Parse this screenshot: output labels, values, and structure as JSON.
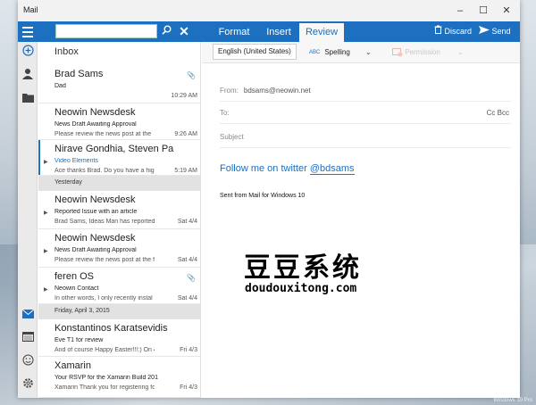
{
  "app": {
    "title": "Mail"
  },
  "window_controls": {
    "minimize": "–",
    "maximize": "☐",
    "close": "✕"
  },
  "search": {
    "value": ""
  },
  "tabs": [
    {
      "label": "Format"
    },
    {
      "label": "Insert"
    },
    {
      "label": "Review",
      "active": true
    }
  ],
  "actions": {
    "discard": "Discard",
    "send": "Send"
  },
  "toolbar": {
    "language": "English (United States)",
    "spelling_icon": "ABC",
    "spelling": "Spelling",
    "permission": "Permission"
  },
  "folder": {
    "title": "Inbox"
  },
  "messages": [
    {
      "from": "Brad Sams",
      "subject": "Dad",
      "preview": "",
      "time": "10:29 AM",
      "attachment": true
    },
    {
      "from": "Neowin Newsdesk",
      "subject": "News Draft Awaiting Approval",
      "preview": "Please review the news post at the",
      "time": "9:26 AM"
    },
    {
      "from": "Nirave Gondhia, Steven Pa",
      "subject": "Video Elements",
      "preview": "Ace thanks Brad. Do you have a hig",
      "time": "5:19 AM",
      "selected": true
    },
    {
      "from": "Neowin Newsdesk",
      "subject": "Reported Issue with an article",
      "preview": "Brad Sams, Ideas Man has reported",
      "time": "Sat 4/4"
    },
    {
      "from": "Neowin Newsdesk",
      "subject": "News Draft Awaiting Approval",
      "preview": "Please review the news post at the f",
      "time": "Sat 4/4"
    },
    {
      "from": "feren OS",
      "subject": "Neowin Contact",
      "preview": "In other words, I only recently instal",
      "time": "Sat 4/4",
      "attachment": true
    },
    {
      "from": "Konstantinos Karatsevidis",
      "subject": "Eve T1 for review",
      "preview": "And of course Happy Easter!!!:) On 4",
      "time": "Fri 4/3"
    },
    {
      "from": "Xamarin",
      "subject": "Your RSVP for the Xamarin Build 201",
      "preview": "Xamarin Thank you for registering fo",
      "time": "Fri 4/3"
    }
  ],
  "sections": {
    "yesterday": "Yesterday",
    "friday": "Friday, April 3, 2015"
  },
  "compose": {
    "from_label": "From:",
    "from_value": "bdsams@neowin.net",
    "to_label": "To:",
    "cc_bcc": "Cc Bcc",
    "subject_placeholder": "Subject",
    "body_text": "Follow me on twitter ",
    "body_handle": "@bdsams",
    "signature": "Sent from Mail for Windows 10"
  },
  "watermark": {
    "title": "豆豆系统",
    "url": "doudouxitong.com"
  },
  "desktop": {
    "badge": "Windows 10 Pro"
  },
  "icons": [
    "menu-icon",
    "search-icon",
    "close-icon",
    "compose-icon",
    "people-icon",
    "folder-icon",
    "mail-icon",
    "calendar-icon",
    "smiley-icon",
    "settings-icon",
    "trash-icon",
    "send-icon",
    "spelling-icon",
    "permission-icon",
    "attachment-icon"
  ]
}
